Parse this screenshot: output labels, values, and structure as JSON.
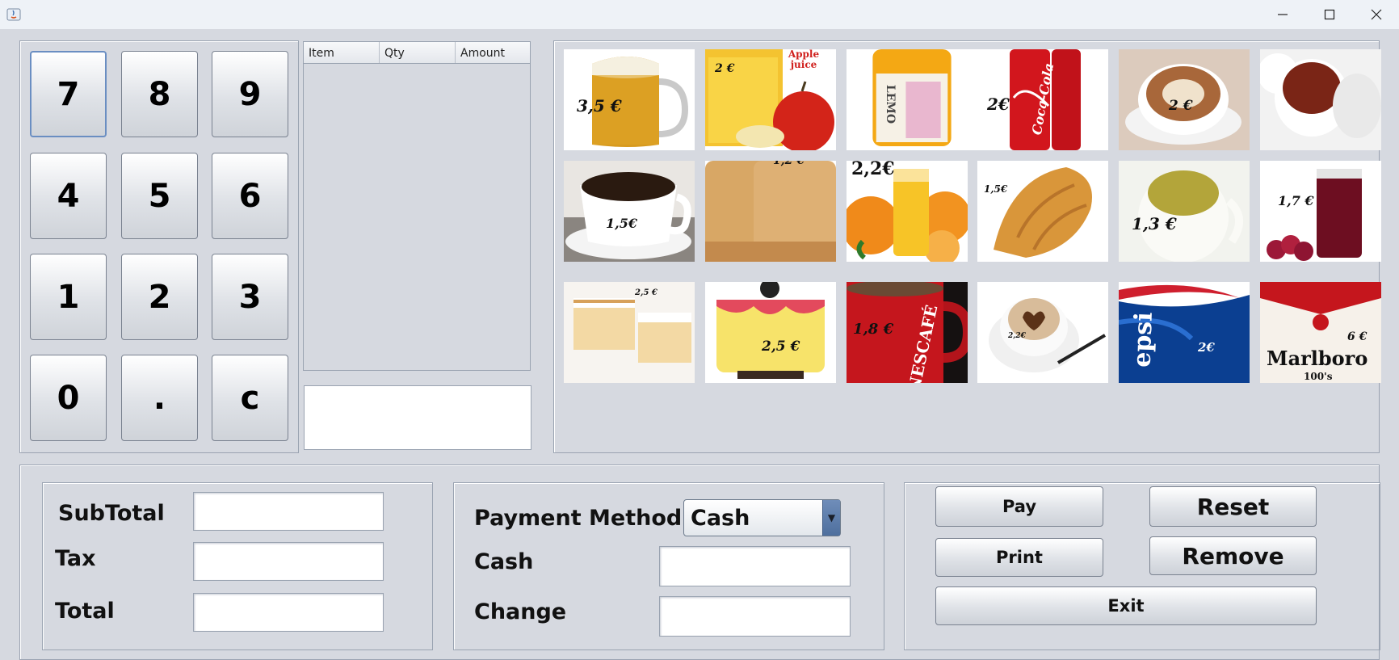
{
  "window": {
    "icons": [
      "java-app-icon",
      "minimize-icon",
      "maximize-icon",
      "close-icon"
    ]
  },
  "keypad": {
    "keys": [
      "7",
      "8",
      "9",
      "4",
      "5",
      "6",
      "1",
      "2",
      "3",
      "0",
      ".",
      "c"
    ]
  },
  "order_table": {
    "columns": [
      "Item",
      "Qty",
      "Amount"
    ],
    "rows": []
  },
  "display_value": "",
  "products": [
    {
      "name": "beer",
      "price": "3,5 €"
    },
    {
      "name": "apple-juice",
      "price": "2 €",
      "label": "Apple juice"
    },
    {
      "name": "lemon-drink",
      "price": "",
      "label": "LEMO"
    },
    {
      "name": "coca-cola",
      "price": "2€",
      "label": "Coca-Cola"
    },
    {
      "name": "cappuccino",
      "price": "2 €"
    },
    {
      "name": "tea",
      "price": ""
    },
    {
      "name": "coffee",
      "price": "1,5€"
    },
    {
      "name": "biscuits",
      "price": "1,2 €"
    },
    {
      "name": "orange-juice",
      "price": "2,2€"
    },
    {
      "name": "croissant",
      "price": "1,5€"
    },
    {
      "name": "green-tea",
      "price": "1,3 €"
    },
    {
      "name": "grape-juice",
      "price": "1,7 €"
    },
    {
      "name": "cake-slices",
      "price": "2,5 €"
    },
    {
      "name": "birthday-cake",
      "price": "2,5 €"
    },
    {
      "name": "nescafe",
      "price": "1,8 €",
      "label": "NESCAFÉ"
    },
    {
      "name": "latte-art",
      "price": "2,2€"
    },
    {
      "name": "pepsi",
      "price": "2€",
      "label": "epsi"
    },
    {
      "name": "marlboro",
      "price": "6 €",
      "label": "Marlboro",
      "sublabel": "100's"
    }
  ],
  "totals": {
    "subtotal_label": "SubTotal",
    "tax_label": "Tax",
    "total_label": "Total",
    "subtotal_value": "",
    "tax_value": "",
    "total_value": ""
  },
  "payment": {
    "method_label": "Payment Method",
    "method_selected": "Cash",
    "cash_label": "Cash",
    "change_label": "Change",
    "cash_value": "",
    "change_value": ""
  },
  "actions": {
    "pay": "Pay",
    "reset": "Reset",
    "print": "Print",
    "remove": "Remove",
    "exit": "Exit"
  },
  "colors": {
    "background": "#d6d9e0",
    "titlebar": "#eef2f7",
    "combo_arrow": "#5a78a6"
  }
}
